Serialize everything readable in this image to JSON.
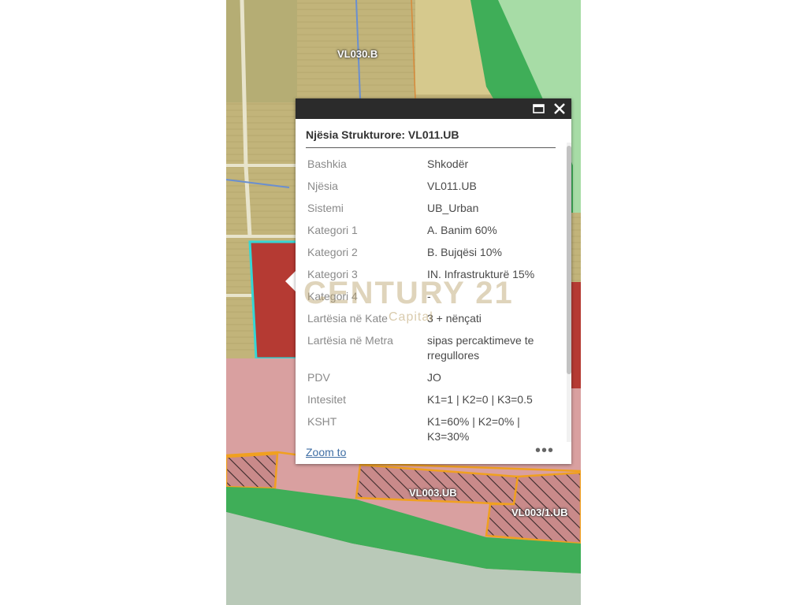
{
  "map": {
    "zone_labels": [
      "VL030.B",
      "VL003.UB",
      "VL003/1.UB"
    ],
    "colors": {
      "field": "#c2b47a",
      "green_zone": "#7ec98a",
      "urban_red": "#b53a33",
      "urban_pink": "#d9a0a0",
      "orange_boundary": "#f0a020",
      "selection": "#35d6d6",
      "sea": "#b9c9b8",
      "parcel_blue": "#6a8fd0"
    }
  },
  "popup": {
    "title": "Njësia Strukturore: VL011.UB",
    "icons": {
      "maximize": "maximize-icon",
      "close": "close-icon"
    },
    "fields": [
      {
        "key": "Bashkia",
        "value": "Shkodër"
      },
      {
        "key": "Njësia",
        "value": "VL011.UB"
      },
      {
        "key": "Sistemi",
        "value": "UB_Urban"
      },
      {
        "key": "Kategori 1",
        "value": "A. Banim 60%"
      },
      {
        "key": "Kategori 2",
        "value": "B. Bujqësi 10%"
      },
      {
        "key": "Kategori 3",
        "value": "IN. Infrastrukturë 15%"
      },
      {
        "key": "Kategori 4",
        "value": "-"
      },
      {
        "key": "Lartësia në Kate",
        "value": "3 + nënçati"
      },
      {
        "key": "Lartësia në Metra",
        "value": "sipas percaktimeve te rregullores"
      },
      {
        "key": "PDV",
        "value": "JO"
      },
      {
        "key": "Intesitet",
        "value": "K1=1 | K2=0 | K3=0.5"
      },
      {
        "key": "KSHT",
        "value": "K1=60% | K2=0% | K3=30%"
      }
    ],
    "zoom_label": "Zoom to",
    "more_label": "•••"
  },
  "watermark": {
    "brand": "CENTURY 21",
    "sub": "Capital"
  }
}
